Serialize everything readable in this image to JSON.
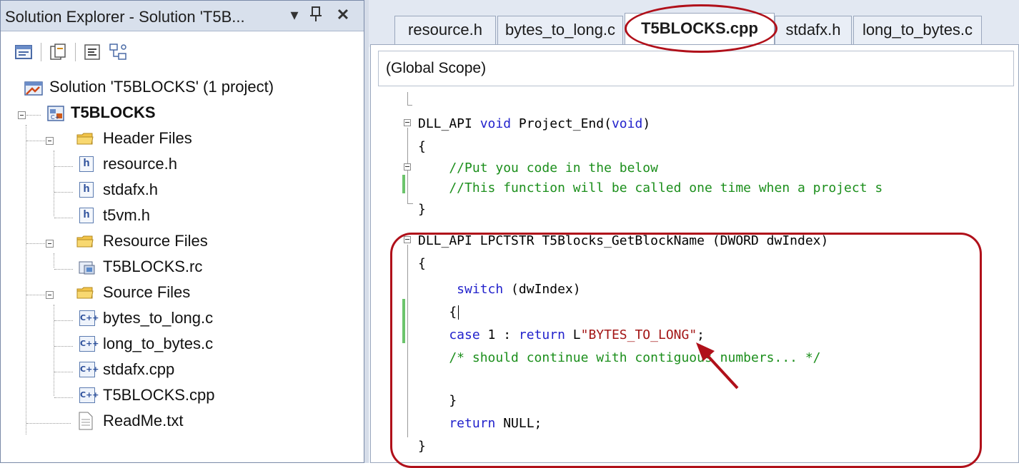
{
  "solution_explorer": {
    "title": "Solution Explorer - Solution 'T5B...",
    "pin_glyph": "☱",
    "dropdown_glyph": "▾",
    "close_glyph": "✕",
    "toolbar_icons": [
      "properties-icon",
      "show-all-files-icon",
      "view-code-icon",
      "class-diagram-icon"
    ],
    "tree": {
      "solution": "Solution 'T5BLOCKS' (1 project)",
      "project": "T5BLOCKS",
      "header_folder": "Header Files",
      "header_files": [
        "resource.h",
        "stdafx.h",
        "t5vm.h"
      ],
      "resource_folder": "Resource Files",
      "resource_files": [
        "T5BLOCKS.rc"
      ],
      "source_folder": "Source Files",
      "source_files": [
        "bytes_to_long.c",
        "long_to_bytes.c",
        "stdafx.cpp",
        "T5BLOCKS.cpp"
      ],
      "readme": "ReadMe.txt",
      "h_badge": "h",
      "cpp_badge": "C++"
    }
  },
  "editor": {
    "tabs": [
      "resource.h",
      "bytes_to_long.c",
      "T5BLOCKS.cpp",
      "stdafx.h",
      "long_to_bytes.c"
    ],
    "active_tab": "T5BLOCKS.cpp",
    "scope": "(Global Scope)",
    "code": {
      "l1_macro": "DLL_API ",
      "l1_kw": "void",
      "l1_name": " Project_End(",
      "l1_param": "void",
      "l1_close": ")",
      "l2": "{",
      "l3": "    //Put you code in the below",
      "l4": "    //This function will be called one time when a project s",
      "l5": "}",
      "l6": "DLL_API LPCTSTR T5Blocks_GetBlockName (DWORD dwIndex)",
      "l7": "{",
      "l8_kw": "     switch",
      "l8_rest": " (dwIndex)",
      "l9": "    {",
      "l10_kw1": "    case",
      "l10_mid": " 1 : ",
      "l10_kw2": "return",
      "l10_pre": " L",
      "l10_str": "\"BYTES_TO_LONG\"",
      "l10_end": ";",
      "l11": "    /* should continue with contiguous numbers... */",
      "l13": "    }",
      "l14_kw": "    return",
      "l14_rest": " NULL;",
      "l15": "}"
    }
  },
  "annotation_color": "#b0101a"
}
